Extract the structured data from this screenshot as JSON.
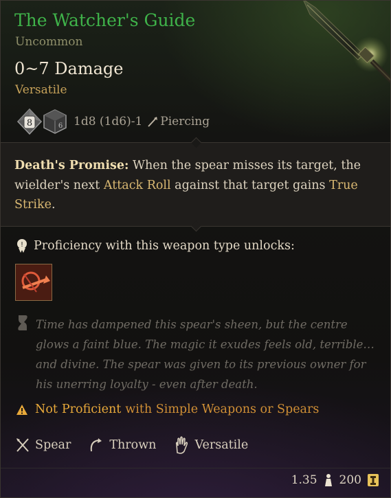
{
  "item": {
    "name": "The Watcher's Guide",
    "rarity": "Uncommon",
    "damage": "0~7 Damage",
    "property_tag": "Versatile",
    "dice_main": "8",
    "dice_text": "1d8 (1d6)-1",
    "damage_type": "Piercing"
  },
  "passive": {
    "name": "Death's Promise:",
    "text_1": " When the spear misses its target, the wielder's next ",
    "link_1": "Attack Roll",
    "text_2": " against that target gains ",
    "link_2": "True Strike",
    "text_3": "."
  },
  "proficiency": {
    "label": "Proficiency with this weapon type unlocks:"
  },
  "lore": "Time has dampened this spear's sheen, but the centre glows a faint blue. The magic it exudes feels old, terrible… and divine. The spear was given to its previous owner for his unerring loyalty - even after death.",
  "warning": {
    "not": "Not",
    "proficient": "Proficient",
    "with": "with Simple Weapons or Spears"
  },
  "properties": [
    {
      "label": "Spear",
      "icon": "spear-type-icon"
    },
    {
      "label": "Thrown",
      "icon": "thrown-icon"
    },
    {
      "label": "Versatile",
      "icon": "versatile-hand-icon"
    }
  ],
  "footer": {
    "weight": "1.35",
    "value": "200"
  },
  "colors": {
    "title": "#3fb34a",
    "rarity": "#8f8f6a",
    "tag": "#c8a35a",
    "warning": "#e8a93a"
  }
}
